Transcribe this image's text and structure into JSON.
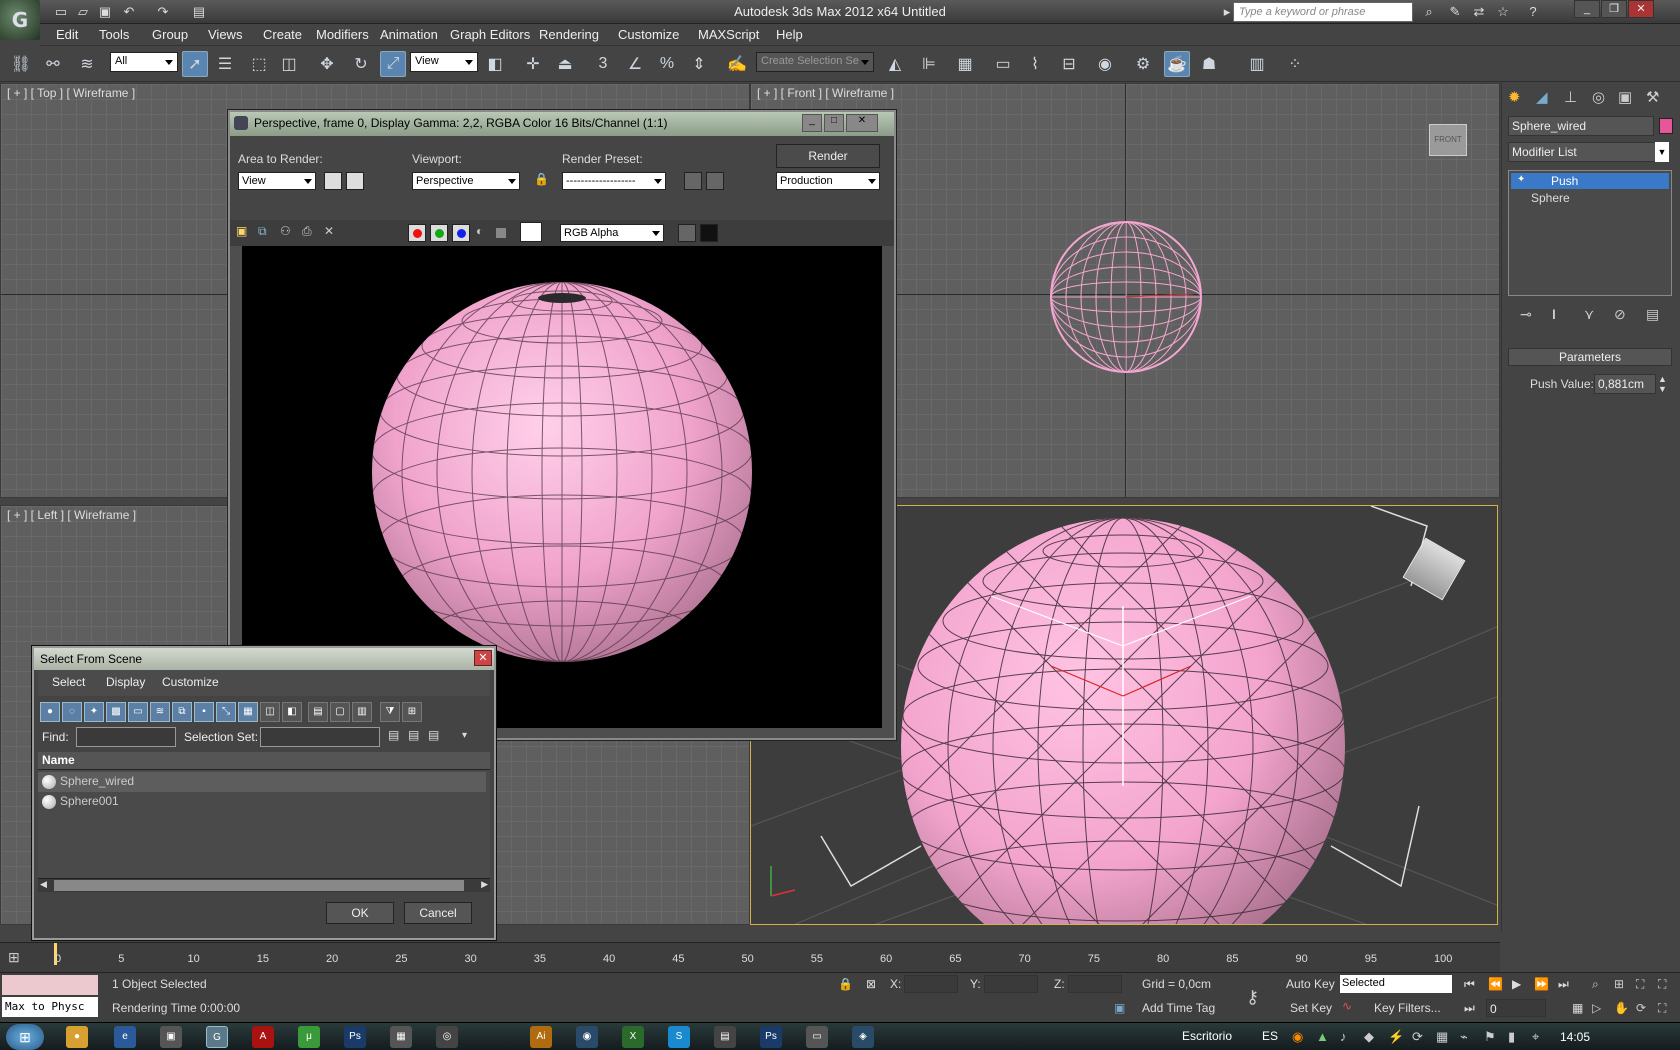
{
  "app": {
    "title": "Autodesk 3ds Max  2012 x64     Untitled",
    "search_placeholder": "Type a keyword or phrase",
    "logo": "3ds-max-logo"
  },
  "menu": [
    "Edit",
    "Tools",
    "Group",
    "Views",
    "Create",
    "Modifiers",
    "Animation",
    "Graph Editors",
    "Rendering",
    "Customize",
    "MAXScript",
    "Help"
  ],
  "toolbar": {
    "selection_filter": "All",
    "reference_coord": "View",
    "named_selection": "Create Selection Se"
  },
  "viewports": {
    "top": "[ + ] [ Top ] [ Wireframe ]",
    "front": "[ + ] [ Front ] [ Wireframe ]",
    "left": "[ + ] [ Left ] [ Wireframe ]",
    "persp_label": "]",
    "front_cube": "FRONT"
  },
  "command_panel": {
    "object_name": "Sphere_wired",
    "object_color": "#e8569a",
    "modifier_list": "Modifier List",
    "stack": [
      "Push",
      "Sphere"
    ],
    "rollout": "Parameters",
    "push_label": "Push Value:",
    "push_value": "0,881cm"
  },
  "render_window": {
    "title": "Perspective, frame 0, Display Gamma: 2,2, RGBA Color 16 Bits/Channel (1:1)",
    "area_label": "Area to Render:",
    "area_value": "View",
    "viewport_label": "Viewport:",
    "viewport_value": "Perspective",
    "preset_label": "Render Preset:",
    "preset_value": "-------------------",
    "render_button": "Render",
    "mode_value": "Production",
    "channel_value": "RGB Alpha"
  },
  "select_dialog": {
    "title": "Select From Scene",
    "menu": [
      "Select",
      "Display",
      "Customize"
    ],
    "find_label": "Find:",
    "selection_set_label": "Selection Set:",
    "column_name": "Name",
    "rows": [
      "Sphere_wired",
      "Sphere001"
    ],
    "ok": "OK",
    "cancel": "Cancel"
  },
  "timeline": {
    "ticks": [
      "0",
      "5",
      "10",
      "15",
      "20",
      "25",
      "30",
      "35",
      "40",
      "45",
      "50",
      "55",
      "60",
      "65",
      "70",
      "75",
      "80",
      "85",
      "90",
      "95",
      "100"
    ]
  },
  "status": {
    "selection": "1 Object Selected",
    "render_time": "Rendering Time  0:00:00",
    "maxscript": "Max to Physc",
    "x_label": "X:",
    "y_label": "Y:",
    "z_label": "Z:",
    "grid": "Grid = 0,0cm",
    "auto_key": "Auto Key",
    "set_key": "Set Key",
    "key_mode": "Selected",
    "key_filters": "Key Filters...",
    "add_time_tag": "Add Time Tag",
    "frame": "0"
  },
  "taskbar": {
    "location": "Escritorio",
    "lang": "ES",
    "clock": "14:05"
  }
}
